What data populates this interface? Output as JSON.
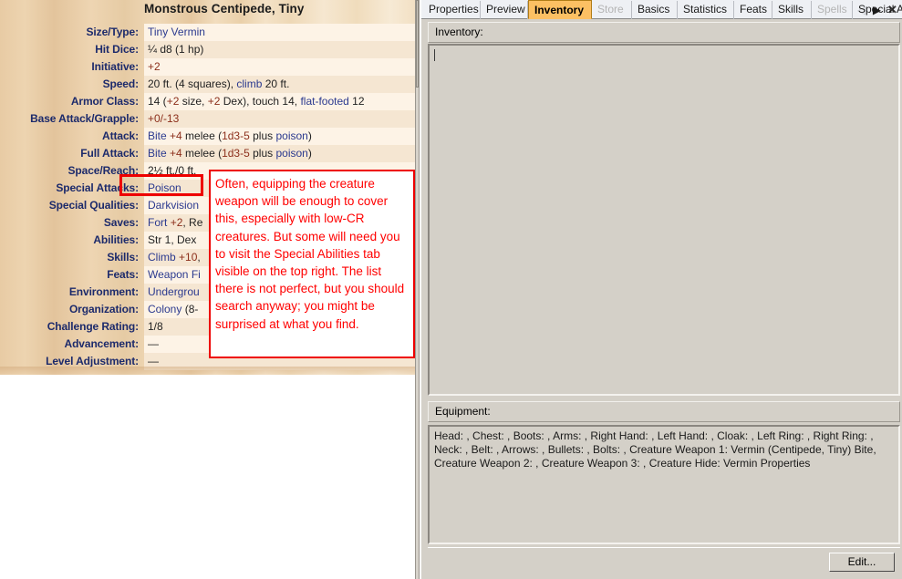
{
  "statblock": {
    "title": "Monstrous Centipede, Tiny",
    "rows": [
      {
        "label": "Size/Type:",
        "value": "Tiny Vermin"
      },
      {
        "label": "Hit Dice:",
        "value": "¼ d8 (1 hp)"
      },
      {
        "label": "Initiative:",
        "value": "+2"
      },
      {
        "label": "Speed:",
        "value": "20 ft. (4 squares), climb 20 ft."
      },
      {
        "label": "Armor Class:",
        "value": "14 (+2 size, +2 Dex), touch 14, flat-footed 12"
      },
      {
        "label": "Base Attack/Grapple:",
        "value": "+0/-13"
      },
      {
        "label": "Attack:",
        "value": "Bite +4 melee (1d3-5 plus poison)"
      },
      {
        "label": "Full Attack:",
        "value": "Bite +4 melee (1d3-5 plus poison)"
      },
      {
        "label": "Space/Reach:",
        "value": "2½ ft./0 ft."
      },
      {
        "label": "Special Attacks:",
        "value": "Poison"
      },
      {
        "label": "Special Qualities:",
        "value": "Darkvision"
      },
      {
        "label": "Saves:",
        "value": "Fort +2, Re"
      },
      {
        "label": "Abilities:",
        "value": "Str 1, Dex"
      },
      {
        "label": "Skills:",
        "value": "Climb +10,"
      },
      {
        "label": "Feats:",
        "value": "Weapon Fi"
      },
      {
        "label": "Environment:",
        "value": "Undergrou"
      },
      {
        "label": "Organization:",
        "value": "Colony (8-"
      },
      {
        "label": "Challenge Rating:",
        "value": "1/8"
      },
      {
        "label": "Advancement:",
        "value": "—"
      },
      {
        "label": "Level Adjustment:",
        "value": "—"
      }
    ]
  },
  "annotation": {
    "text": "Often, equipping the creature weapon will be enough to cover this, especially with low-CR creatures. But some will need you to visit the Special Abilities tab visible on the top right. The list there is not perfect, but you should search anyway; you might be surprised at what you find.",
    "color": "#ff0000",
    "highlight_target": "Poison"
  },
  "tabs": [
    {
      "label": "Properties",
      "state": "normal"
    },
    {
      "label": "Preview",
      "state": "normal"
    },
    {
      "label": "Inventory",
      "state": "active"
    },
    {
      "label": "Store",
      "state": "disabled"
    },
    {
      "label": "Basics",
      "state": "normal"
    },
    {
      "label": "Statistics",
      "state": "normal"
    },
    {
      "label": "Feats",
      "state": "normal"
    },
    {
      "label": "Skills",
      "state": "normal"
    },
    {
      "label": "Spells",
      "state": "disabled"
    },
    {
      "label": "Special Abili",
      "state": "normal"
    }
  ],
  "tabnav": {
    "prev_icon": "◁",
    "next_icon": "▶",
    "close_icon": "✕"
  },
  "inventory": {
    "header_label": "Inventory:",
    "items": []
  },
  "equipment": {
    "header_label": "Equipment:",
    "text": "Head: , Chest: , Boots: , Arms: , Right Hand: , Left Hand: , Cloak: , Left Ring: , Right Ring: , Neck: , Belt: , Arrows: , Bullets: , Bolts: , Creature Weapon 1: Vermin (Centipede, Tiny) Bite, Creature Weapon 2: , Creature Weapon 3: , Creature Hide: Vermin Properties"
  },
  "footer": {
    "edit_label": "Edit..."
  },
  "colors": {
    "tab_active_bg": "#fcc063",
    "annotation_red": "#ff0000",
    "label_navy": "#1c2a6b",
    "link_blue": "#2b3a8f",
    "number_red": "#8c2f1b",
    "panel_gray": "#d4d0c8"
  }
}
